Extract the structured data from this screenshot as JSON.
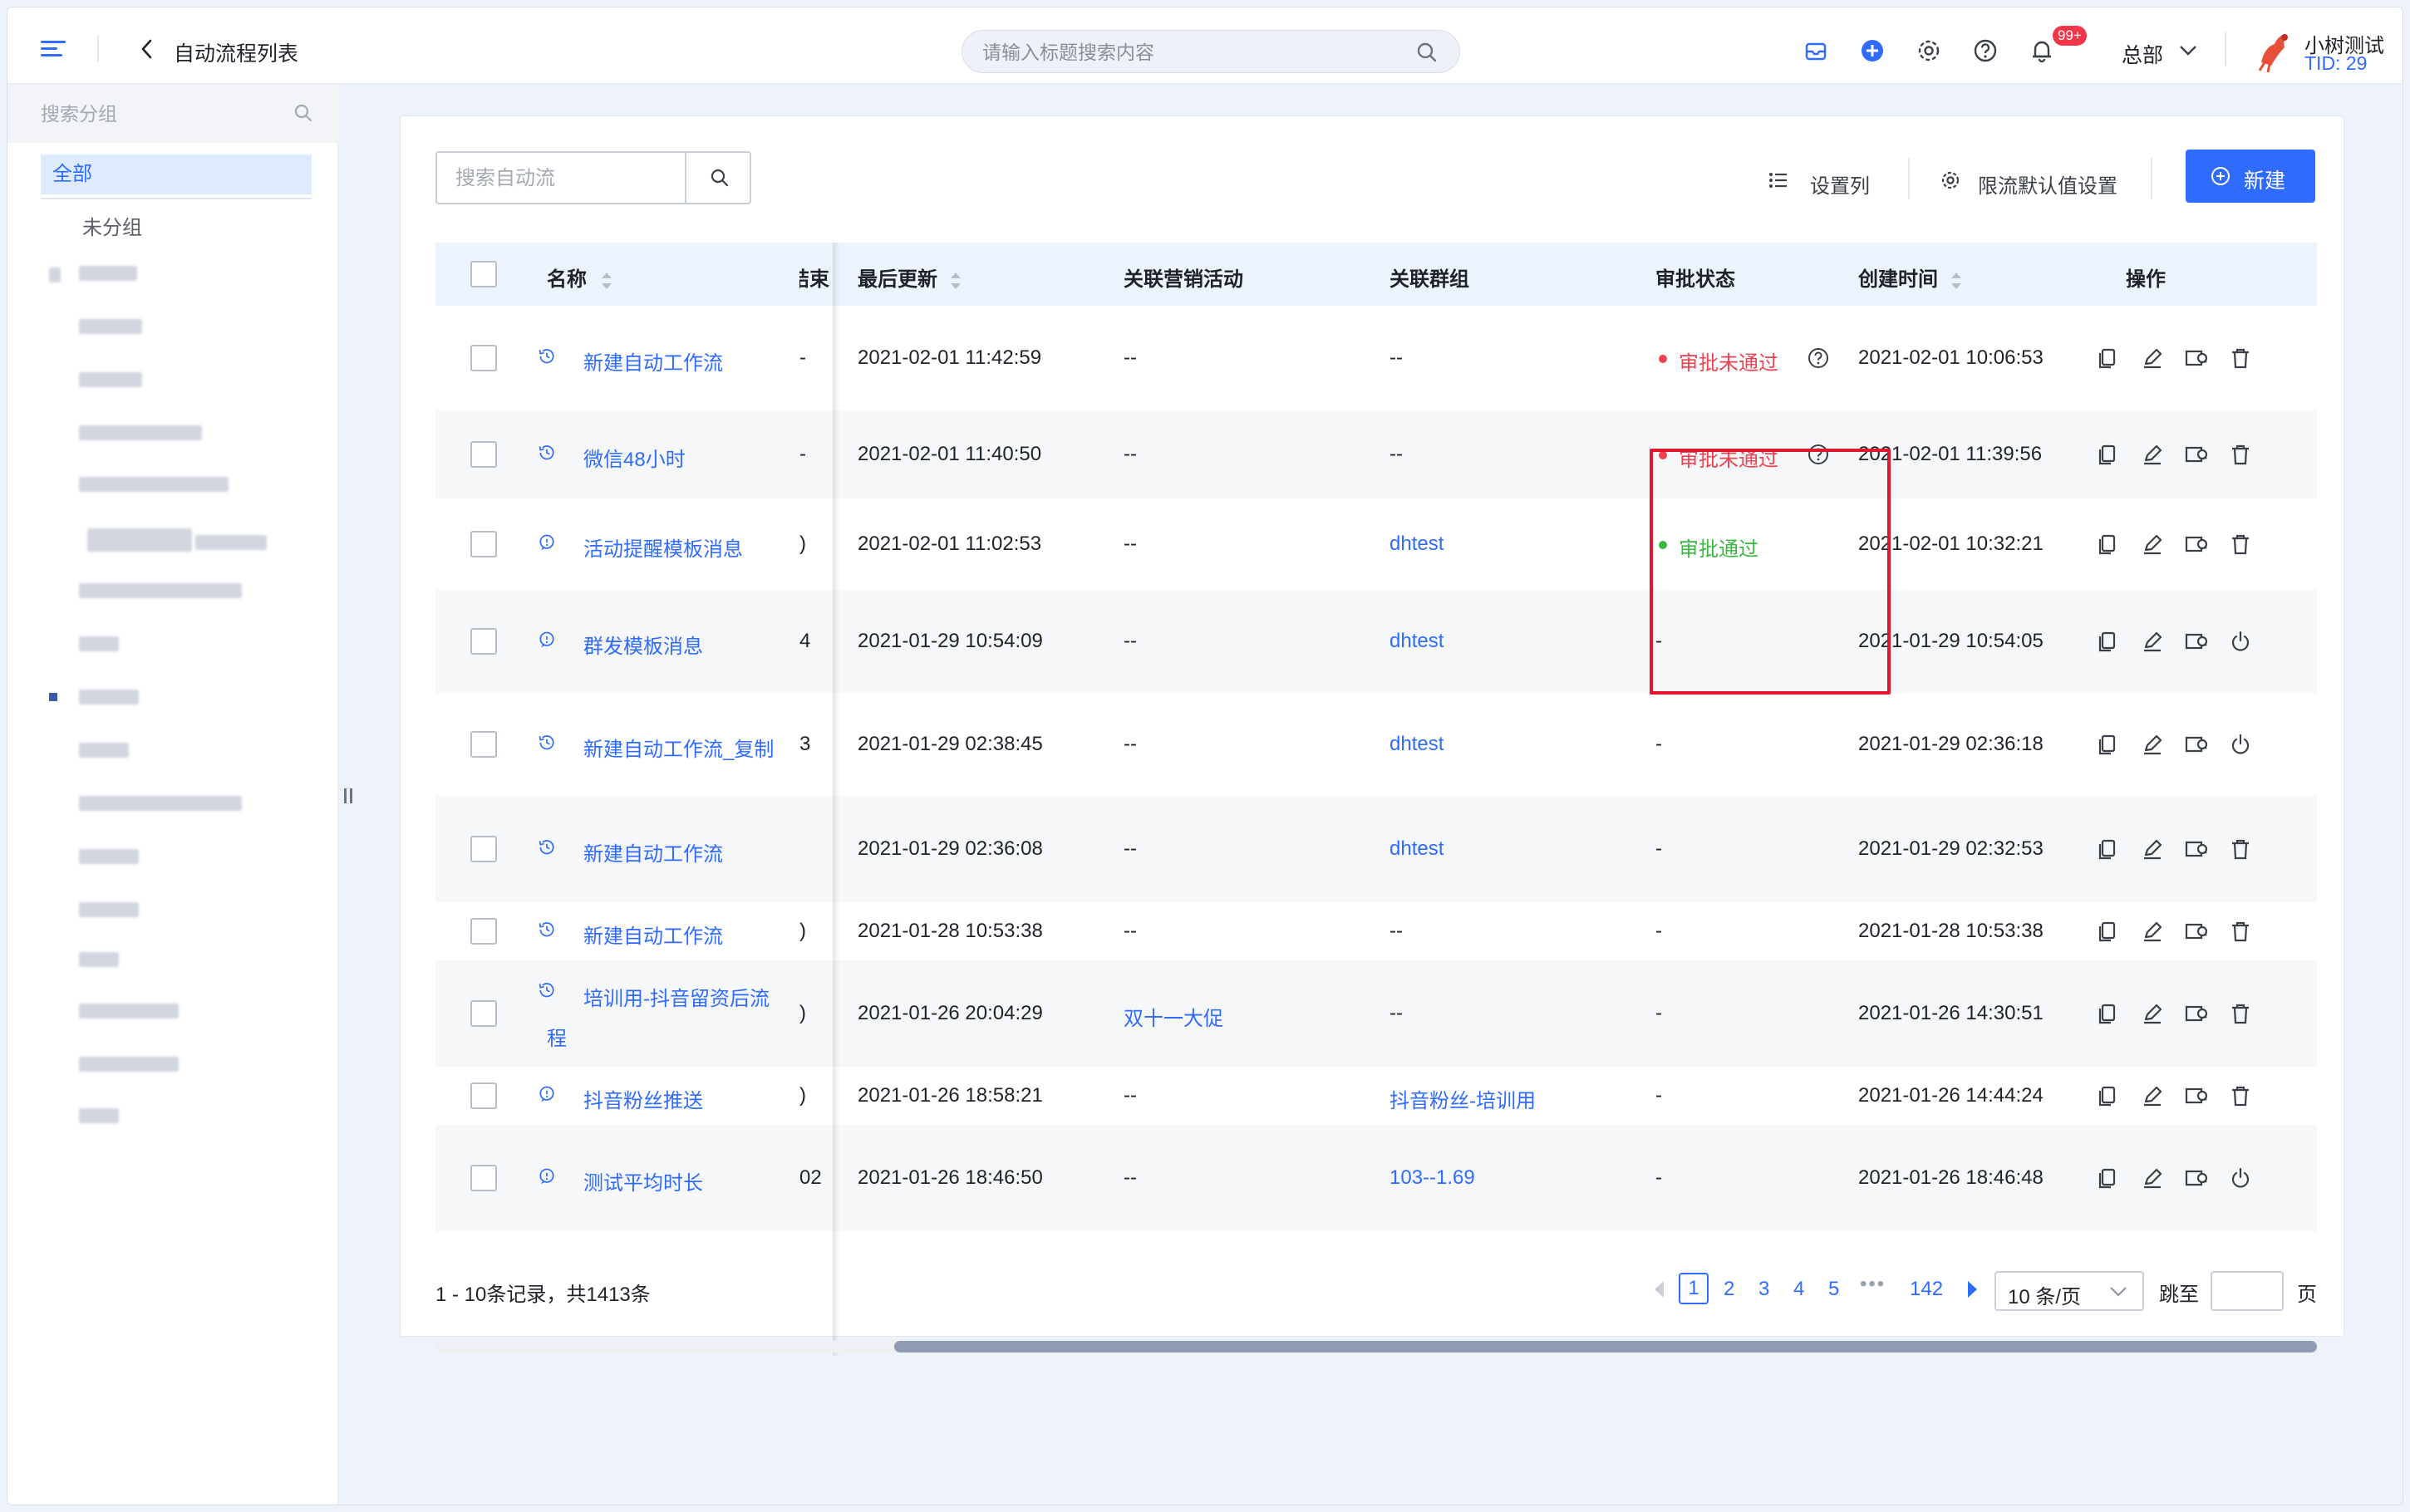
{
  "topbar": {
    "title": "自动流程列表",
    "search_placeholder": "请输入标题搜索内容",
    "notification_badge": "99+",
    "org": "总部",
    "user_name": "小树测试",
    "user_tid": "TID: 29"
  },
  "sidebar": {
    "search_placeholder": "搜索分组",
    "all": "全部",
    "ungrouped": "未分组"
  },
  "toolbar": {
    "search_placeholder": "搜索自动流",
    "set_columns": "设置列",
    "rate_limit": "限流默认值设置",
    "new": "新建"
  },
  "table": {
    "headers": {
      "name": "名称",
      "end": "结束",
      "updated": "最后更新",
      "campaign": "关联营销活动",
      "group": "关联群组",
      "status": "审批状态",
      "created": "创建时间",
      "actions": "操作"
    },
    "rows": [
      {
        "name": "新建自动工作流",
        "end": "-",
        "updated": "2021-02-01 11:42:59",
        "campaign": "--",
        "group": "--",
        "status": "审批未通过",
        "created": "2021-02-01 10:06:53"
      },
      {
        "name": "微信48小时",
        "end": "-",
        "updated": "2021-02-01 11:40:50",
        "campaign": "--",
        "group": "--",
        "status": "审批未通过",
        "created": "2021-02-01 11:39:56"
      },
      {
        "name": "活动提醒模板消息",
        "end": ")",
        "updated": "2021-02-01 11:02:53",
        "campaign": "--",
        "group": "dhtest",
        "status": "审批通过",
        "created": "2021-02-01 10:32:21"
      },
      {
        "name": "群发模板消息",
        "end": "4",
        "updated": "2021-01-29 10:54:09",
        "campaign": "--",
        "group": "dhtest",
        "status": "-",
        "created": "2021-01-29 10:54:05"
      },
      {
        "name": "新建自动工作流_复制",
        "end": "3",
        "updated": "2021-01-29 02:38:45",
        "campaign": "--",
        "group": "dhtest",
        "status": "-",
        "created": "2021-01-29 02:36:18"
      },
      {
        "name": "新建自动工作流",
        "end": "",
        "updated": "2021-01-29 02:36:08",
        "campaign": "--",
        "group": "dhtest",
        "status": "-",
        "created": "2021-01-29 02:32:53"
      },
      {
        "name": "新建自动工作流",
        "end": ")",
        "updated": "2021-01-28 10:53:38",
        "campaign": "--",
        "group": "--",
        "status": "-",
        "created": "2021-01-28 10:53:38"
      },
      {
        "name_line1": "培训用-抖音留资后流",
        "name_line2": "程",
        "end": ")",
        "updated": "2021-01-26 20:04:29",
        "campaign": "双十一大促",
        "group": "--",
        "status": "-",
        "created": "2021-01-26 14:30:51"
      },
      {
        "name": "抖音粉丝推送",
        "end": ")",
        "updated": "2021-01-26 18:58:21",
        "campaign": "--",
        "group": "抖音粉丝-培训用",
        "status": "-",
        "created": "2021-01-26 14:44:24"
      },
      {
        "name": "测试平均时长",
        "end": "02",
        "updated": "2021-01-26 18:46:50",
        "campaign": "--",
        "group": "103--1.69",
        "status": "-",
        "created": "2021-01-26 18:46:48"
      }
    ]
  },
  "pagination": {
    "summary": "1 - 10条记录，共1413条",
    "pages": [
      "1",
      "2",
      "3",
      "4",
      "5"
    ],
    "ellipsis": "•••",
    "last": "142",
    "page_size": "10 条/页",
    "jump": "跳至",
    "page": "页"
  },
  "colors": {
    "primary": "#2f6bff",
    "rejected": "#f0424f",
    "approved": "#3bb83f",
    "highlight": "#e0182d"
  }
}
